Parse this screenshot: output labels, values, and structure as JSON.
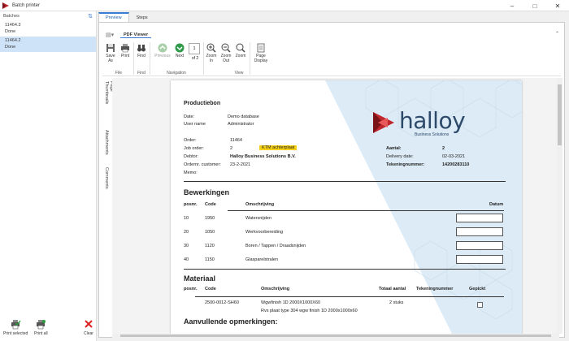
{
  "window": {
    "title": "Batch printer",
    "icon": "batch-printer-logo-icon"
  },
  "batches_panel": {
    "title": "Batches",
    "items": [
      {
        "id": "11464.3",
        "status": "Done",
        "selected": false
      },
      {
        "id": "11464.2",
        "status": "Done",
        "selected": true
      }
    ],
    "actions": {
      "print_selected": "Print selected",
      "print_all": "Print all",
      "clear": "Clear"
    }
  },
  "tabs": [
    "Preview",
    "Steps"
  ],
  "pdf_viewer": {
    "ribbon_tab": "PDF Viewer",
    "groups": {
      "file": "File",
      "find": "Find",
      "navigation": "Navigation",
      "view": "View"
    },
    "buttons": {
      "save_as": "Save As",
      "print": "Print",
      "find": "Find",
      "previous": "Previous",
      "next": "Next",
      "zoom_in": "Zoom In",
      "zoom_out": "Zoom Out",
      "zoom": "Zoom",
      "page_display": "Page Display"
    },
    "page_number": "1",
    "page_of": "of 2",
    "side_tabs": [
      "Page Thumbnails",
      "Attachments",
      "Comments"
    ]
  },
  "document": {
    "title": "Productiebon",
    "fields": {
      "date_label": "Date:",
      "date_value": "Demo database",
      "user_label": "User name",
      "user_value": "Administrator",
      "order_label": "Order:",
      "order_value": "11464",
      "job_label": "Job order:",
      "job_value": "2",
      "job_badge": "KTM achterplaat",
      "debtor_label": "Debtor:",
      "debtor_value": "Halloy Business Solutions B.V.",
      "ordernr_label": "Ordernr. customer:",
      "ordernr_value": "23-2-2021",
      "memo_label": "Memo:"
    },
    "right_fields": {
      "aantal_label": "Aantal:",
      "aantal_value": "2",
      "delivery_label": "Delivery date:",
      "delivery_value": "02-03-2021",
      "tekening_label": "Tekeningnummer:",
      "tekening_value": "14200283110"
    },
    "logo": {
      "name": "halloy",
      "tagline": "Business Solutions",
      "brand_color": "#2d4a6b",
      "accent_color": "#c0272d"
    },
    "bewerkingen": {
      "title": "Bewerkingen",
      "columns": [
        "posnr.",
        "Code",
        "Omschrijving",
        "Datum"
      ],
      "rows": [
        {
          "posnr": "10",
          "code": "1950",
          "omschrijving": "Watersnijden"
        },
        {
          "posnr": "20",
          "code": "1050",
          "omschrijving": "Werkvoorbereiding"
        },
        {
          "posnr": "30",
          "code": "1120",
          "omschrijving": "Boren / Tappen / Draadsnijden"
        },
        {
          "posnr": "40",
          "code": "1150",
          "omschrijving": "Glasparelstralen"
        }
      ]
    },
    "materiaal": {
      "title": "Materiaal",
      "columns": [
        "posnr.",
        "Code",
        "Omschrijving",
        "Totaal aantal",
        "Tekeningnummer",
        "Gepickt"
      ],
      "rows": [
        {
          "posnr": "",
          "code": "2500-0012-SH60",
          "omschrijving": "Wgwfinish 1D 2000X1000X60",
          "omschrijving2": "Rvs plaat type 304 wgw finish 1D 2000x1000x60",
          "totaal": "2 stuks"
        }
      ]
    },
    "aanvullende": "Aanvullende opmerkingen:"
  }
}
